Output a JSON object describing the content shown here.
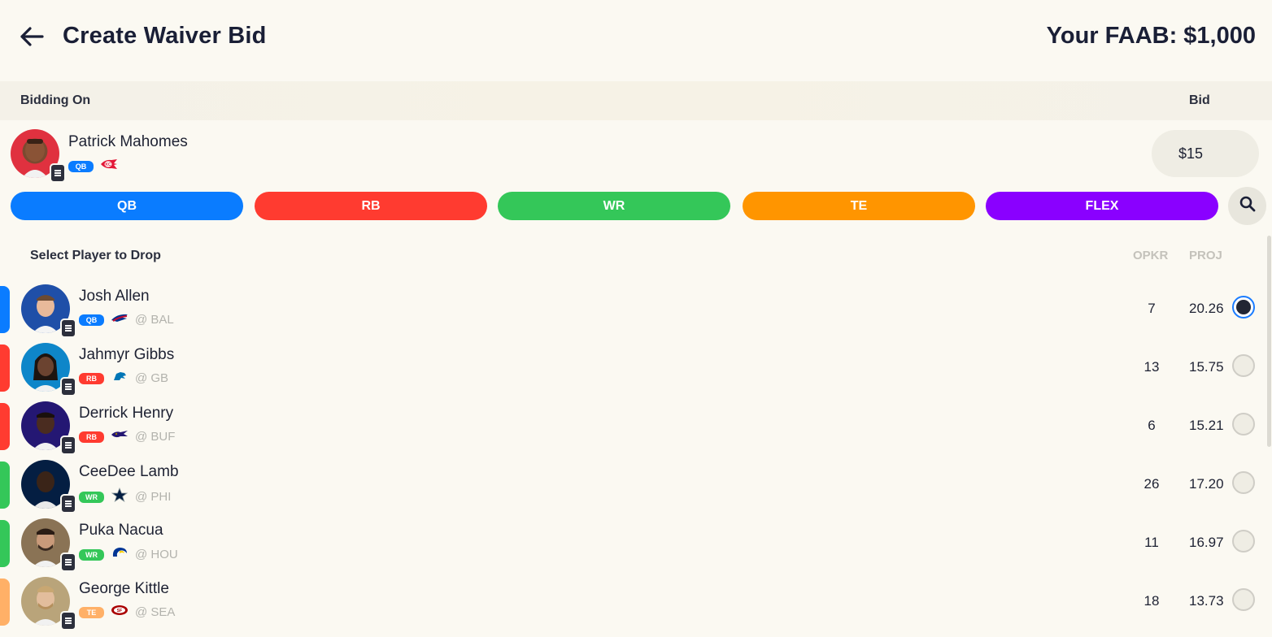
{
  "header": {
    "title": "Create Waiver Bid",
    "faab_label": "Your FAAB: $1,000"
  },
  "bidding": {
    "bidding_on_label": "Bidding On",
    "bid_label": "Bid",
    "player": {
      "name": "Patrick Mahomes",
      "position": "QB",
      "team_logo": "chiefs-logo"
    },
    "bid_currency": "$",
    "bid_value": "15"
  },
  "filters": [
    {
      "label": "QB",
      "color": "#0a7cff"
    },
    {
      "label": "RB",
      "color": "#ff3b30"
    },
    {
      "label": "WR",
      "color": "#34c759"
    },
    {
      "label": "TE",
      "color": "#ff9500"
    },
    {
      "label": "FLEX",
      "color": "#8a00ff"
    }
  ],
  "list": {
    "select_label": "Select Player to Drop",
    "col_opkr": "OPKR",
    "col_proj": "PROJ"
  },
  "players": [
    {
      "name": "Josh Allen",
      "position": "QB",
      "color": "#0a7cff",
      "team_logo": "bills-logo",
      "opponent": "@ BAL",
      "opkr": "7",
      "proj": "20.26",
      "selected": true
    },
    {
      "name": "Jahmyr Gibbs",
      "position": "RB",
      "color": "#ff3b30",
      "team_logo": "lions-logo",
      "opponent": "@ GB",
      "opkr": "13",
      "proj": "15.75",
      "selected": false
    },
    {
      "name": "Derrick Henry",
      "position": "RB",
      "color": "#ff3b30",
      "team_logo": "ravens-logo",
      "opponent": "@ BUF",
      "opkr": "6",
      "proj": "15.21",
      "selected": false
    },
    {
      "name": "CeeDee Lamb",
      "position": "WR",
      "color": "#34c759",
      "team_logo": "cowboys-logo",
      "opponent": "@ PHI",
      "opkr": "26",
      "proj": "17.20",
      "selected": false
    },
    {
      "name": "Puka Nacua",
      "position": "WR",
      "color": "#34c759",
      "team_logo": "rams-logo",
      "opponent": "@ HOU",
      "opkr": "11",
      "proj": "16.97",
      "selected": false
    },
    {
      "name": "George Kittle",
      "position": "TE",
      "color": "#ffb067",
      "team_logo": "49ers-logo",
      "opponent": "@ SEA",
      "opkr": "18",
      "proj": "13.73",
      "selected": false
    }
  ]
}
